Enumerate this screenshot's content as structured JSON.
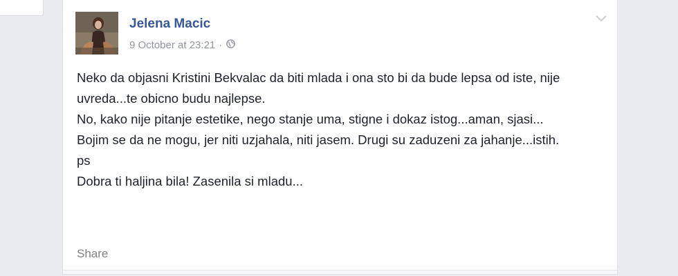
{
  "post": {
    "author": "Jelena Macic",
    "timestamp": "9 October at 23:21",
    "separator": "·",
    "audience_icon": "globe-icon",
    "menu_icon": "chevron-down-icon",
    "paragraphs": [
      "Neko da objasni Kristini Bekvalac da biti mlada i ona sto bi da bude lepsa od iste, nije uvreda...te obicno budu najlepse.",
      "No, kako nije pitanje estetike, nego stanje uma, stigne i dokaz istog...aman, sjasi...",
      "Bojim se da ne mogu, jer niti uzjahala, niti jasem. Drugi su zaduzeni za jahanje...istih.",
      "ps",
      "Dobra ti haljina bila! Zasenila si mladu..."
    ],
    "share_label": "Share"
  },
  "colors": {
    "page_background": "#e9ebee",
    "author_link": "#365899",
    "meta_text": "#90949c",
    "body_text": "#1d2129"
  }
}
